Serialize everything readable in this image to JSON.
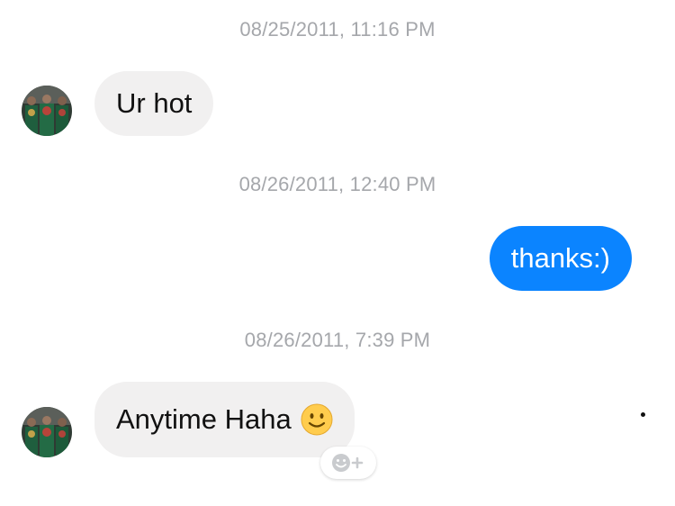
{
  "messages": [
    {
      "timestamp": "08/25/2011, 11:16 PM",
      "direction": "incoming",
      "text": "Ur hot"
    },
    {
      "timestamp": "08/26/2011, 12:40 PM",
      "direction": "outgoing",
      "text": "thanks:)"
    },
    {
      "timestamp": "08/26/2011, 7:39 PM",
      "direction": "incoming",
      "text": "Anytime Haha",
      "emoji": "slightly-smiling-face"
    }
  ],
  "reaction_button": {
    "icon": "smiley-add-icon"
  },
  "colors": {
    "outgoing_bubble": "#0b84ff",
    "incoming_bubble": "#f1f0f0",
    "timestamp_text": "#a5a7ab",
    "emoji_yellow": "#ffcc4d"
  }
}
